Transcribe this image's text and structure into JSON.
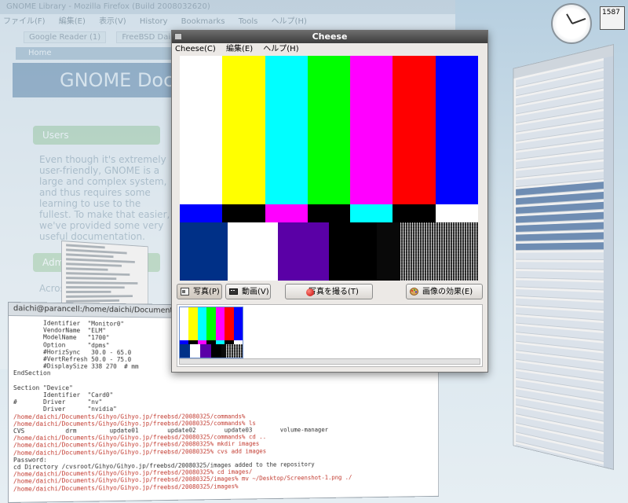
{
  "firefox": {
    "title": "GNOME Library - Mozilla Firefox (Build 2008032620)",
    "menu": [
      "ファイル(F)",
      "編集(E)",
      "表示(V)",
      "History",
      "Bookmarks",
      "Tools",
      "ヘルプ(H)"
    ],
    "tabs": [
      "Google Reader (1)",
      "FreeBSD Daily To..."
    ],
    "home": "Home",
    "header": "GNOME Documentation Library",
    "users_button": "Users",
    "paragraph": "Even though it's extremely user-friendly, GNOME is a large and complex system, and thus requires some learning to use to the fullest. To make that easier, we've provided some very useful documentation.",
    "admin_button": "Administrators",
    "across_text": "Across"
  },
  "clock_widget": {
    "value": "1587"
  },
  "terminal": {
    "title": "daichi@parancell:/home/daichi/Documents/Gihyo/Gihyo.jp/freebsd/20080325/images",
    "lines": [
      {
        "text": "        Identifier  \"Monitor0\"",
        "prompt": false
      },
      {
        "text": "        VendorName  \"ELM\"",
        "prompt": false
      },
      {
        "text": "        ModelName   \"1700\"",
        "prompt": false
      },
      {
        "text": "        Option      \"dpms\"",
        "prompt": false
      },
      {
        "text": "        #HorizSync   30.0 - 65.0",
        "prompt": false
      },
      {
        "text": "        #VertRefresh 50.0 - 75.0",
        "prompt": false
      },
      {
        "text": "        #DisplaySize 338 270  # mm",
        "prompt": false
      },
      {
        "text": "EndSection",
        "prompt": false
      },
      {
        "text": "",
        "prompt": false
      },
      {
        "text": "Section \"Device\"",
        "prompt": false
      },
      {
        "text": "        Identifier  \"Card0\"",
        "prompt": false
      },
      {
        "text": "#       Driver      \"nv\"",
        "prompt": false
      },
      {
        "text": "        Driver      \"nvidia\"",
        "prompt": false
      },
      {
        "text": "/home/daichi/Documents/Gihyo/Gihyo.jp/freebsd/20080325/commands%",
        "prompt": true
      },
      {
        "text": "/home/daichi/Documents/Gihyo/Gihyo.jp/freebsd/20080325/commands% ls",
        "prompt": true
      },
      {
        "text": "CVS           drm         update01        update02        update03        volume-manager",
        "prompt": false
      },
      {
        "text": "/home/daichi/Documents/Gihyo/Gihyo.jp/freebsd/20080325/commands% cd ..",
        "prompt": true
      },
      {
        "text": "/home/daichi/Documents/Gihyo/Gihyo.jp/freebsd/20080325% mkdir images",
        "prompt": true
      },
      {
        "text": "/home/daichi/Documents/Gihyo/Gihyo.jp/freebsd/20080325% cvs add images",
        "prompt": true
      },
      {
        "text": "Password:",
        "prompt": false
      },
      {
        "text": "cd Directory /cvsroot/Gihyo/Gihyo.jp/freebsd/20080325/images added to the repository",
        "prompt": false
      },
      {
        "text": "/home/daichi/Documents/Gihyo/Gihyo.jp/freebsd/20080325% cd images/",
        "prompt": true
      },
      {
        "text": "/home/daichi/Documents/Gihyo/Gihyo.jp/freebsd/20080325/images% mv ~/Desktop/Screenshot-1.png ./",
        "prompt": true
      },
      {
        "text": "/home/daichi/Documents/Gihyo/Gihyo.jp/freebsd/20080325/images% ",
        "prompt": true
      }
    ]
  },
  "cheese": {
    "title": "Cheese",
    "menu": [
      "Cheese(C)",
      "編集(E)",
      "ヘルプ(H)"
    ],
    "buttons": {
      "photo": "写真(P)",
      "video": "動画(V)",
      "take_photo": "写真を撮る(T)",
      "effects": "画像の効果(E)"
    },
    "test_pattern_colors": [
      "#ffffff",
      "#ffff00",
      "#00ffff",
      "#00ff00",
      "#ff00ff",
      "#ff0000",
      "#0000ff"
    ],
    "mid_band_colors": [
      "#0000ff",
      "#000000",
      "#ff00ff",
      "#000000",
      "#00ffff",
      "#000000",
      "#ffffff"
    ],
    "bottom_band_colors": [
      "#003087",
      "#ffffff",
      "#5a00a6",
      "#000000",
      "#090909",
      "#1d1d1d"
    ]
  }
}
